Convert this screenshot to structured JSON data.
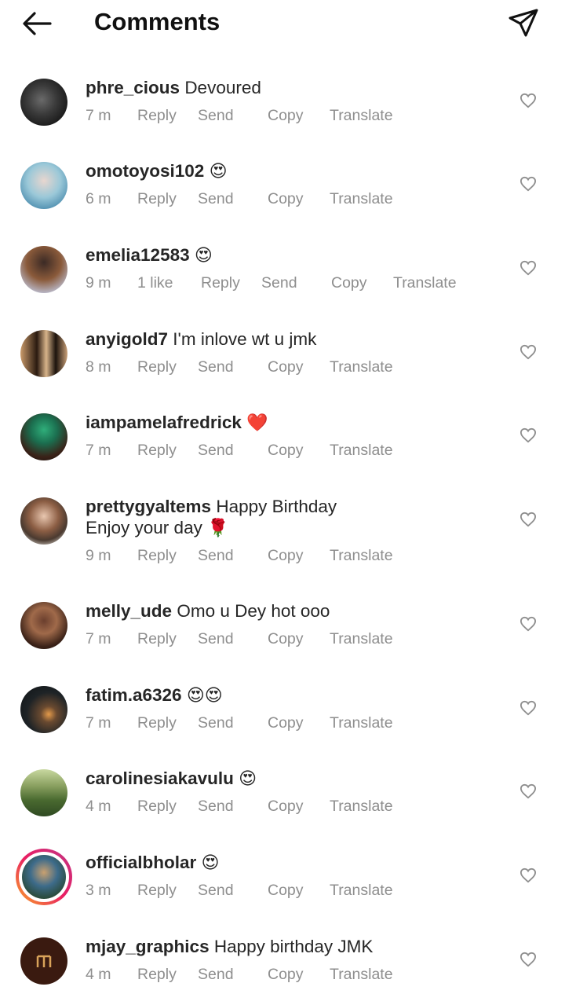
{
  "header": {
    "title": "Comments",
    "back_icon": "arrow-left-icon",
    "share_icon": "paper-plane-icon"
  },
  "actions": {
    "reply": "Reply",
    "send": "Send",
    "copy": "Copy",
    "translate": "Translate"
  },
  "comments": [
    {
      "username": "phre_cious",
      "text": "Devoured",
      "emoji": "",
      "time": "7 m",
      "likes": ""
    },
    {
      "username": "omotoyosi102",
      "text": "",
      "emoji": "😍",
      "time": "6 m",
      "likes": ""
    },
    {
      "username": "emelia12583",
      "text": "",
      "emoji": "😍",
      "time": "9 m",
      "likes": "1 like"
    },
    {
      "username": "anyigold7",
      "text": "I'm inlove wt u jmk",
      "emoji": "",
      "time": "8 m",
      "likes": ""
    },
    {
      "username": "iampamelafredrick",
      "text": "",
      "emoji": "❤️",
      "time": "7 m",
      "likes": ""
    },
    {
      "username": "prettygyaltems",
      "text": "Happy Birthday",
      "text2": "Enjoy your day",
      "emoji2": "🌹",
      "time": "9 m",
      "likes": ""
    },
    {
      "username": "melly_ude",
      "text": "Omo u Dey hot ooo",
      "emoji": "",
      "time": "7 m",
      "likes": ""
    },
    {
      "username": "fatim.a6326",
      "text": "",
      "emoji": "😍😍",
      "time": "7 m",
      "likes": ""
    },
    {
      "username": "carolinesiakavulu",
      "text": "",
      "emoji": "😍",
      "time": "4 m",
      "likes": ""
    },
    {
      "username": "officialbholar",
      "text": "",
      "emoji": "😍",
      "time": "3 m",
      "likes": ""
    },
    {
      "username": "mjay_graphics",
      "text": "Happy birthday JMK",
      "emoji": "",
      "time": "4 m",
      "likes": ""
    }
  ],
  "colors": {
    "text": "#262626",
    "meta": "#8e8e8e",
    "story_ring_start": "#f9a825",
    "story_ring_end": "#c13584"
  }
}
